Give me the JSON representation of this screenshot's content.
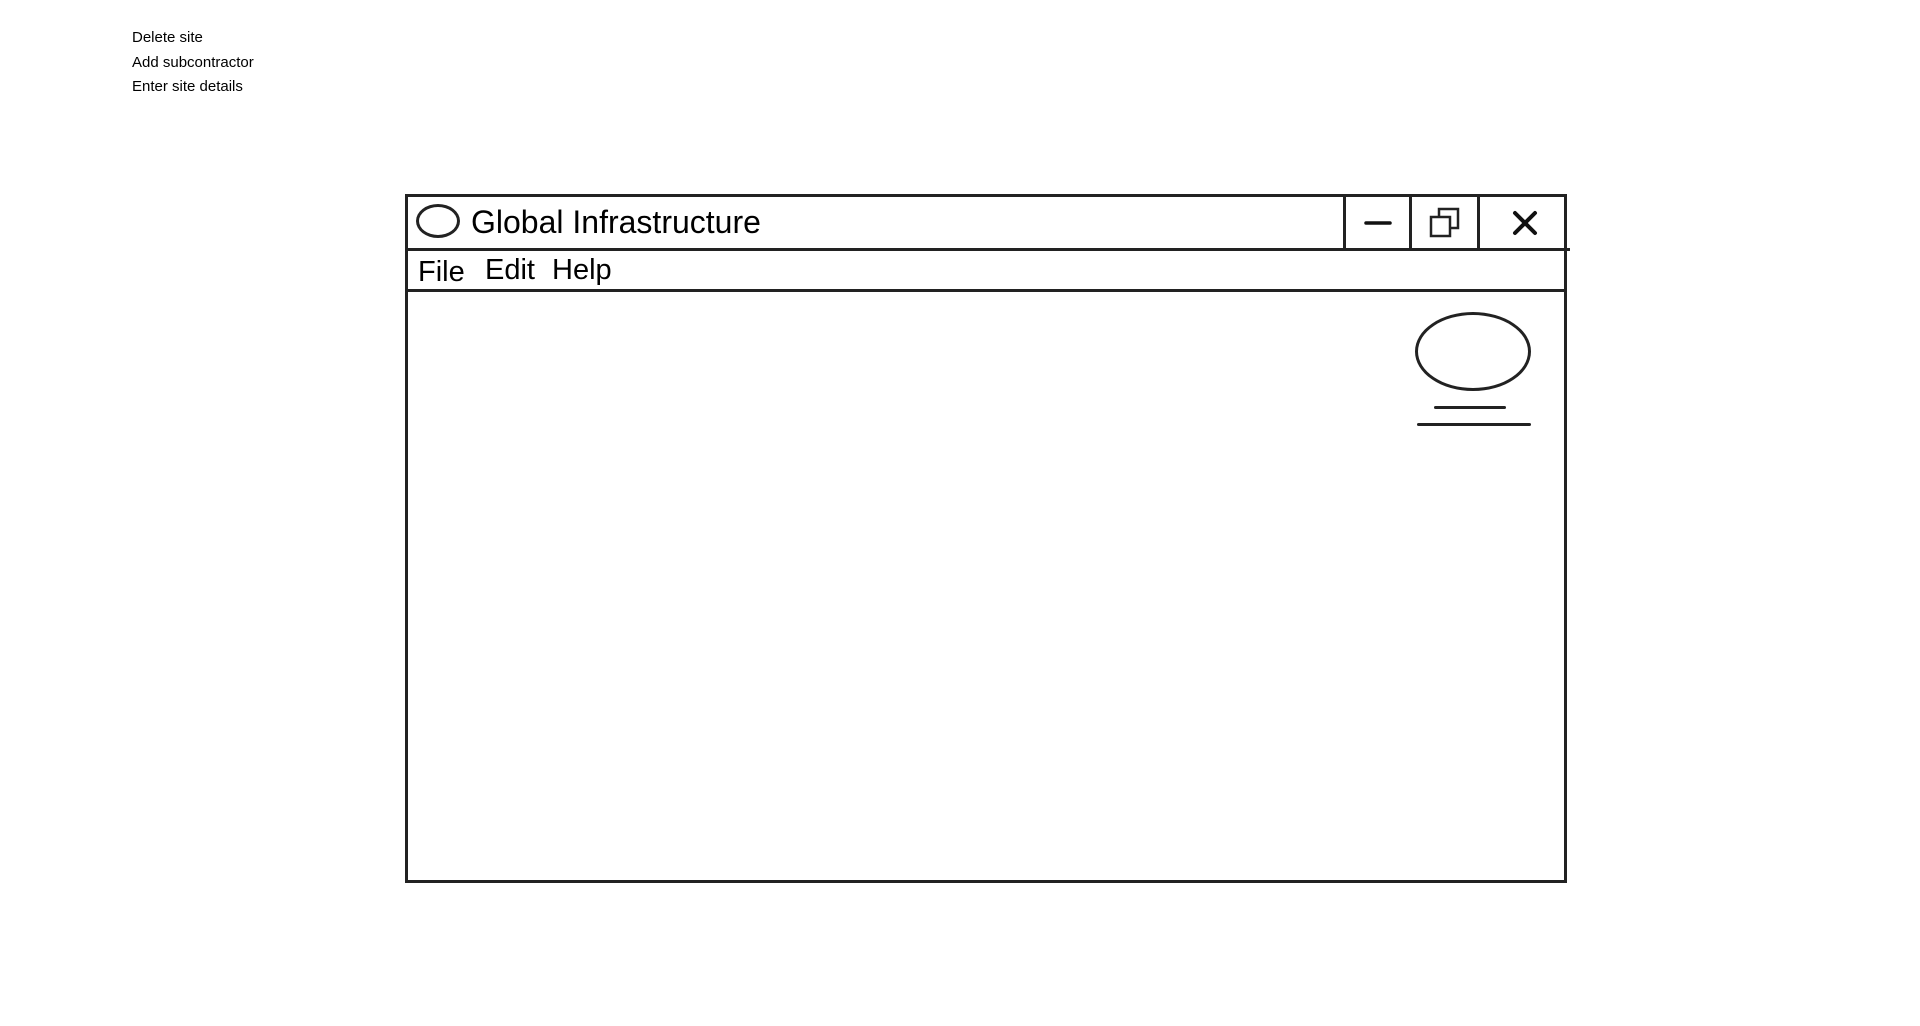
{
  "actions": [
    {
      "label": "Delete site"
    },
    {
      "label": "Add subcontractor"
    },
    {
      "label": "Enter site details"
    }
  ],
  "window": {
    "title": "Global Infrastructure",
    "controls": {
      "minimize_icon": "minimize-icon",
      "maximize_icon": "restore-icon",
      "close_icon": "close-icon"
    }
  },
  "menu": {
    "items": [
      {
        "label": "File"
      },
      {
        "label": "Edit"
      },
      {
        "label": "Help"
      }
    ]
  },
  "content": {
    "avatar_icon": "user-avatar-icon"
  }
}
